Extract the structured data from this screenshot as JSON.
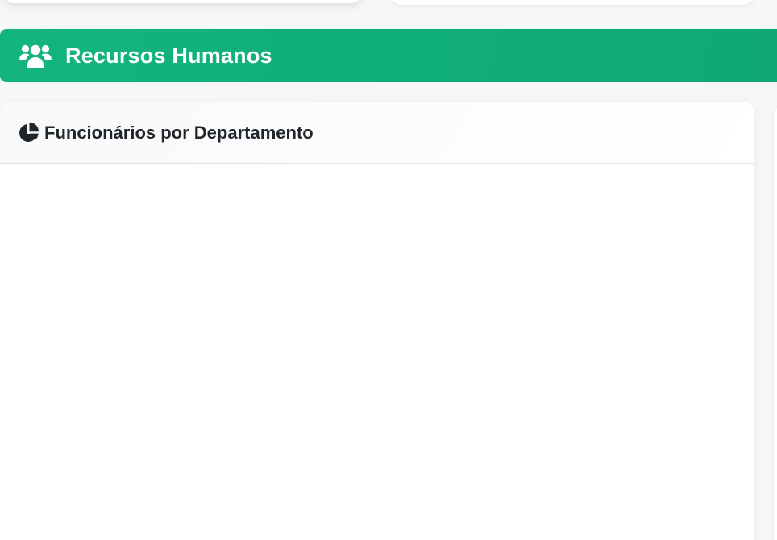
{
  "section": {
    "title": "Recursos Humanos",
    "icon": "users-icon",
    "accent_color": "#10b27b"
  },
  "chart_card": {
    "title": "Funcionários por Departamento",
    "icon": "pie-chart-icon"
  }
}
